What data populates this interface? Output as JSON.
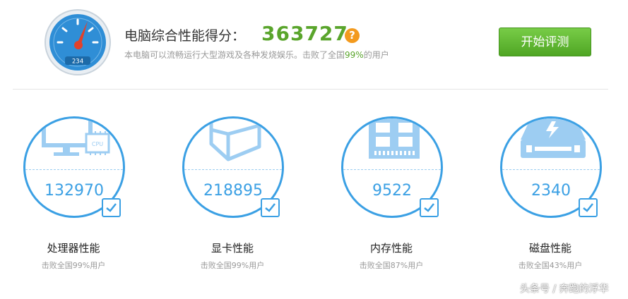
{
  "header": {
    "title": "电脑综合性能得分：",
    "score": "363727",
    "help": "?",
    "gauge_readout": "234",
    "subtitle_prefix": "本电脑可以流畅运行大型游戏及各种发烧娱乐。击败了全国",
    "subtitle_percent": "99%",
    "subtitle_suffix": "的用户",
    "start_button": "开始评测"
  },
  "cards": [
    {
      "value": "132970",
      "label": "处理器性能",
      "sub": "击败全国99%用户",
      "icon": "cpu-monitor-icon",
      "chip_text": "CPU"
    },
    {
      "value": "218895",
      "label": "显卡性能",
      "sub": "击败全国99%用户",
      "icon": "gpu-cube-icon"
    },
    {
      "value": "9522",
      "label": "内存性能",
      "sub": "击败全国87%用户",
      "icon": "memory-chip-icon"
    },
    {
      "value": "2340",
      "label": "磁盘性能",
      "sub": "击败全国43%用户",
      "icon": "disk-drive-icon"
    }
  ],
  "watermark": "头条号 / 奔跑的浮华",
  "colors": {
    "accent": "#3ba0e4",
    "green": "#5aa52c",
    "orange": "#f39a1d"
  }
}
